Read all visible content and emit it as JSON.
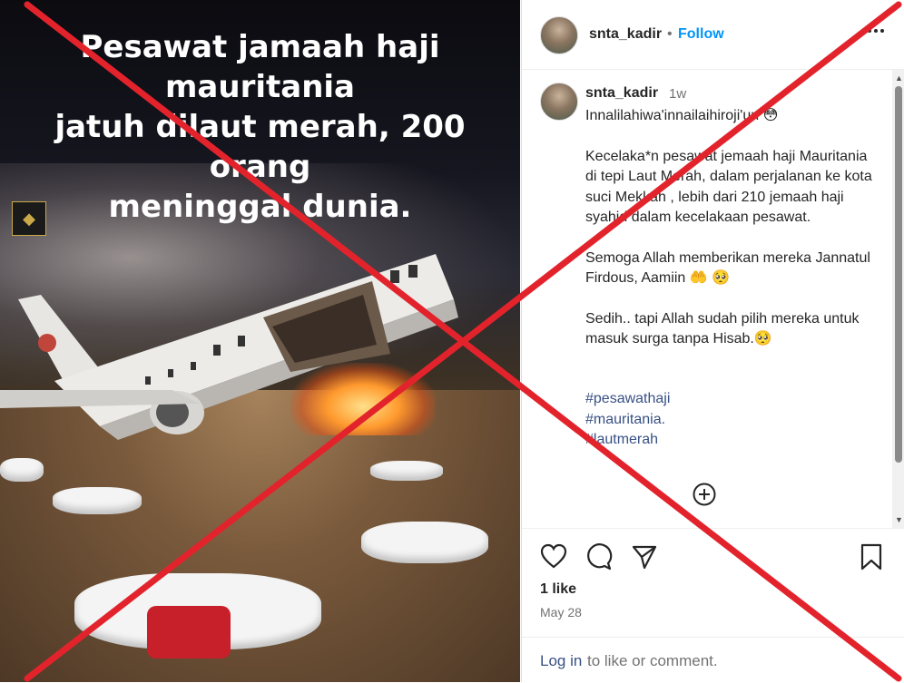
{
  "media": {
    "caption": "Pesawat jamaah haji mauritania\njatuh dilaut merah, 200 orang\nmeninggal dunia.",
    "overlay_mark": "red-x",
    "overlay_color": "#e3232c"
  },
  "header": {
    "username": "snta_kadir",
    "separator": "•",
    "follow_label": "Follow",
    "more_label": "•••"
  },
  "post": {
    "username": "snta_kadir",
    "time": "1w",
    "paragraphs": [
      "Innalilahiwa'innailaihiroji'un 😳",
      "Kecelaka*n pesawat jemaah haji Mauritania di tepi Laut Merah, dalam perjalanan ke kota suci Mekkah , lebih dari 210 jemaah haji syahid dalam kecelakaan pesawat.",
      "Semoga Allah memberikan mereka Jannatul Firdous, Aamiin 🤲 🥺",
      "Sedih.. tapi Allah sudah pilih mereka untuk masuk surga tanpa Hisab.🥺"
    ],
    "hashtags": [
      "#pesawathaji",
      "#mauritania.",
      "#lautmerah"
    ]
  },
  "actions": {
    "likes": "1 like",
    "date": "May 28"
  },
  "footer": {
    "login": "Log in",
    "rest": " to like or comment."
  },
  "colors": {
    "accent": "#0095f6",
    "hashtag": "#385185",
    "muted": "#737373",
    "text": "#262626"
  }
}
